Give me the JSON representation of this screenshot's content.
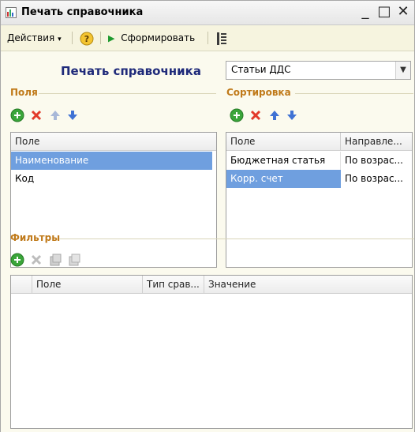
{
  "window": {
    "title": "Печать справочника"
  },
  "toolbar": {
    "actions_label": "Действия",
    "form_label": "Сформировать"
  },
  "main": {
    "heading": "Печать справочника",
    "catalog_select": {
      "value": "Статьи ДДС"
    }
  },
  "fields": {
    "title": "Поля",
    "column_header": "Поле",
    "rows": [
      "Наименование",
      "Код"
    ]
  },
  "sort": {
    "title": "Сортировка",
    "column_headers": [
      "Поле",
      "Направле..."
    ],
    "rows": [
      {
        "field": "Бюджетная статья",
        "direction": "По возрас..."
      },
      {
        "field": "Корр. счет",
        "direction": "По возрас..."
      }
    ]
  },
  "filters": {
    "title": "Фильтры",
    "column_headers": [
      "Поле",
      "Тип срав...",
      "Значение"
    ]
  },
  "colors": {
    "selection": "#6f9fdf",
    "section_title": "#c07a1a",
    "heading": "#1f2a7a"
  }
}
